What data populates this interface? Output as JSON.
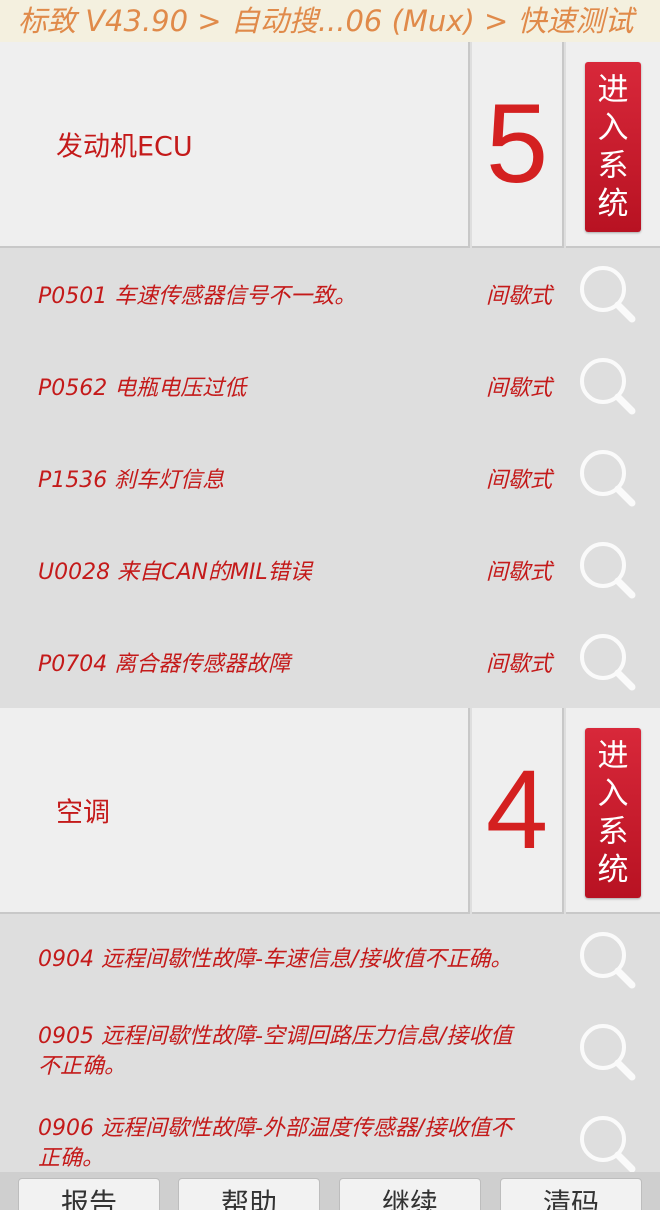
{
  "header": {
    "breadcrumb": "标致 V43.90 > 自动搜...06 (Mux) > 快速测试"
  },
  "systems": [
    {
      "name": "发动机ECU",
      "count": "5",
      "enter_label": [
        "进",
        "入",
        "系",
        "统"
      ],
      "faults": [
        {
          "text": "P0501 车速传感器信号不一致。",
          "status": "间歇式"
        },
        {
          "text": "P0562 电瓶电压过低",
          "status": "间歇式"
        },
        {
          "text": "P1536 刹车灯信息",
          "status": "间歇式"
        },
        {
          "text": "U0028 来自CAN的MIL错误",
          "status": "间歇式"
        },
        {
          "text": "P0704 离合器传感器故障",
          "status": "间歇式"
        }
      ]
    },
    {
      "name": "空调",
      "count": "4",
      "enter_label": [
        "进",
        "入",
        "系",
        "统"
      ],
      "faults": [
        {
          "text": "0904 远程间歇性故障-车速信息/接收值不正确。",
          "status": ""
        },
        {
          "text": "0905 远程间歇性故障-空调回路压力信息/接收值不正确。",
          "status": ""
        },
        {
          "text": "0906 远程间歇性故障-外部温度传感器/接收值不正确。",
          "status": ""
        }
      ]
    }
  ],
  "bottom_bar": {
    "buttons": [
      "报告",
      "帮助",
      "继续",
      "清码"
    ]
  },
  "icons": {
    "search": "search-icon"
  },
  "colors": {
    "accent_red": "#c41a1a",
    "title_orange": "#e08a4a",
    "enter_button": "#c81a2c"
  }
}
